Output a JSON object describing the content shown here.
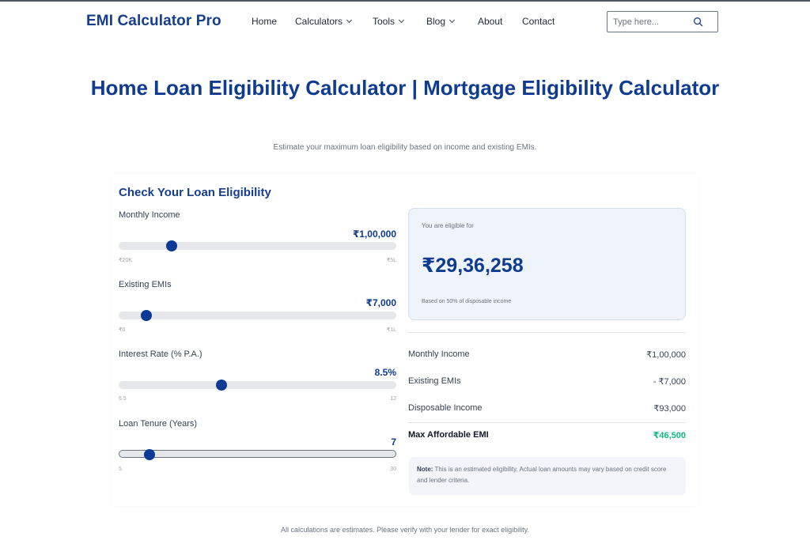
{
  "header": {
    "brand": "EMI Calculator Pro",
    "nav": [
      {
        "label": "Home",
        "dropdown": false
      },
      {
        "label": "Calculators",
        "dropdown": true
      },
      {
        "label": "Tools",
        "dropdown": true
      },
      {
        "label": "Blog",
        "dropdown": true
      },
      {
        "label": "About",
        "dropdown": false
      },
      {
        "label": "Contact",
        "dropdown": false
      }
    ],
    "search": {
      "placeholder": "Type here...",
      "value": "",
      "icon": "search-icon"
    }
  },
  "page": {
    "title": "Home Loan Eligibility Calculator | Mortgage Eligibility Calculator",
    "subtitle": "Estimate your maximum loan eligibility based on income and existing EMIs."
  },
  "form": {
    "title": "Check Your Loan Eligibility",
    "fields": [
      {
        "label": "Monthly Income",
        "value": "₹1,00,000",
        "min": "₹20K",
        "max": "₹5L",
        "position": 0.19
      },
      {
        "label": "Existing EMIs",
        "value": "₹7,000",
        "min": "₹0",
        "max": "₹1L",
        "position": 0.1
      },
      {
        "label": "Interest Rate (% P.A.)",
        "value": "8.5%",
        "min": "6.5",
        "max": "12",
        "position": 0.37
      },
      {
        "label": "Loan Tenure (Years)",
        "value": "7",
        "min": "5",
        "max": "30",
        "position": 0.11
      }
    ]
  },
  "result": {
    "label": "You are eligible for",
    "amount": "₹29,36,258",
    "note": "Based on 50% of disposable income",
    "rows": [
      {
        "label": "Monthly Income",
        "value": "₹1,00,000"
      },
      {
        "label": "Existing EMIs",
        "value": "- ₹7,000"
      },
      {
        "label": "Disposable Income",
        "value": "₹93,000"
      },
      {
        "label": "Max Affordable EMI",
        "value": "₹46,500"
      }
    ],
    "disclaimer_label": "Note:",
    "disclaimer": "This is an estimated eligibility. Actual loan amounts may vary based on credit score and lender criteria."
  },
  "colors": {
    "accent": "#0f3b91",
    "positive": "#10b981"
  },
  "footer": {
    "text": "All calculations are estimates. Please verify with your lender for exact eligibility."
  }
}
